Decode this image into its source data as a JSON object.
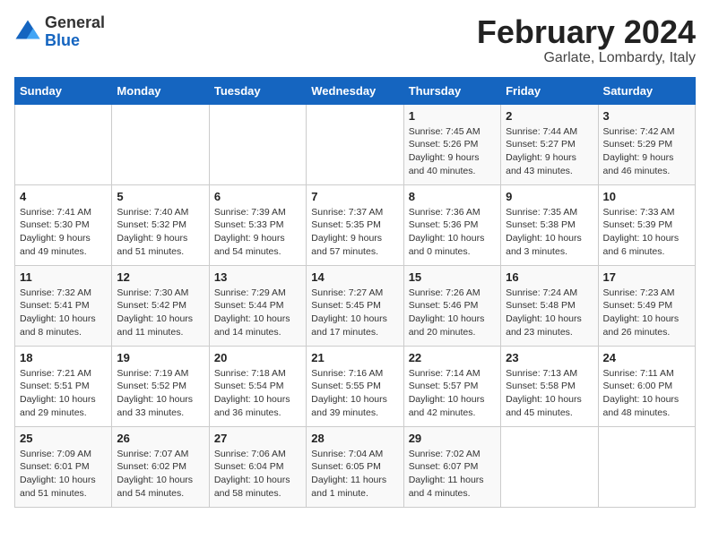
{
  "header": {
    "logo_general": "General",
    "logo_blue": "Blue",
    "title": "February 2024",
    "subtitle": "Garlate, Lombardy, Italy"
  },
  "days_of_week": [
    "Sunday",
    "Monday",
    "Tuesday",
    "Wednesday",
    "Thursday",
    "Friday",
    "Saturday"
  ],
  "weeks": [
    [
      {
        "day": "",
        "info": ""
      },
      {
        "day": "",
        "info": ""
      },
      {
        "day": "",
        "info": ""
      },
      {
        "day": "",
        "info": ""
      },
      {
        "day": "1",
        "info": "Sunrise: 7:45 AM\nSunset: 5:26 PM\nDaylight: 9 hours\nand 40 minutes."
      },
      {
        "day": "2",
        "info": "Sunrise: 7:44 AM\nSunset: 5:27 PM\nDaylight: 9 hours\nand 43 minutes."
      },
      {
        "day": "3",
        "info": "Sunrise: 7:42 AM\nSunset: 5:29 PM\nDaylight: 9 hours\nand 46 minutes."
      }
    ],
    [
      {
        "day": "4",
        "info": "Sunrise: 7:41 AM\nSunset: 5:30 PM\nDaylight: 9 hours\nand 49 minutes."
      },
      {
        "day": "5",
        "info": "Sunrise: 7:40 AM\nSunset: 5:32 PM\nDaylight: 9 hours\nand 51 minutes."
      },
      {
        "day": "6",
        "info": "Sunrise: 7:39 AM\nSunset: 5:33 PM\nDaylight: 9 hours\nand 54 minutes."
      },
      {
        "day": "7",
        "info": "Sunrise: 7:37 AM\nSunset: 5:35 PM\nDaylight: 9 hours\nand 57 minutes."
      },
      {
        "day": "8",
        "info": "Sunrise: 7:36 AM\nSunset: 5:36 PM\nDaylight: 10 hours\nand 0 minutes."
      },
      {
        "day": "9",
        "info": "Sunrise: 7:35 AM\nSunset: 5:38 PM\nDaylight: 10 hours\nand 3 minutes."
      },
      {
        "day": "10",
        "info": "Sunrise: 7:33 AM\nSunset: 5:39 PM\nDaylight: 10 hours\nand 6 minutes."
      }
    ],
    [
      {
        "day": "11",
        "info": "Sunrise: 7:32 AM\nSunset: 5:41 PM\nDaylight: 10 hours\nand 8 minutes."
      },
      {
        "day": "12",
        "info": "Sunrise: 7:30 AM\nSunset: 5:42 PM\nDaylight: 10 hours\nand 11 minutes."
      },
      {
        "day": "13",
        "info": "Sunrise: 7:29 AM\nSunset: 5:44 PM\nDaylight: 10 hours\nand 14 minutes."
      },
      {
        "day": "14",
        "info": "Sunrise: 7:27 AM\nSunset: 5:45 PM\nDaylight: 10 hours\nand 17 minutes."
      },
      {
        "day": "15",
        "info": "Sunrise: 7:26 AM\nSunset: 5:46 PM\nDaylight: 10 hours\nand 20 minutes."
      },
      {
        "day": "16",
        "info": "Sunrise: 7:24 AM\nSunset: 5:48 PM\nDaylight: 10 hours\nand 23 minutes."
      },
      {
        "day": "17",
        "info": "Sunrise: 7:23 AM\nSunset: 5:49 PM\nDaylight: 10 hours\nand 26 minutes."
      }
    ],
    [
      {
        "day": "18",
        "info": "Sunrise: 7:21 AM\nSunset: 5:51 PM\nDaylight: 10 hours\nand 29 minutes."
      },
      {
        "day": "19",
        "info": "Sunrise: 7:19 AM\nSunset: 5:52 PM\nDaylight: 10 hours\nand 33 minutes."
      },
      {
        "day": "20",
        "info": "Sunrise: 7:18 AM\nSunset: 5:54 PM\nDaylight: 10 hours\nand 36 minutes."
      },
      {
        "day": "21",
        "info": "Sunrise: 7:16 AM\nSunset: 5:55 PM\nDaylight: 10 hours\nand 39 minutes."
      },
      {
        "day": "22",
        "info": "Sunrise: 7:14 AM\nSunset: 5:57 PM\nDaylight: 10 hours\nand 42 minutes."
      },
      {
        "day": "23",
        "info": "Sunrise: 7:13 AM\nSunset: 5:58 PM\nDaylight: 10 hours\nand 45 minutes."
      },
      {
        "day": "24",
        "info": "Sunrise: 7:11 AM\nSunset: 6:00 PM\nDaylight: 10 hours\nand 48 minutes."
      }
    ],
    [
      {
        "day": "25",
        "info": "Sunrise: 7:09 AM\nSunset: 6:01 PM\nDaylight: 10 hours\nand 51 minutes."
      },
      {
        "day": "26",
        "info": "Sunrise: 7:07 AM\nSunset: 6:02 PM\nDaylight: 10 hours\nand 54 minutes."
      },
      {
        "day": "27",
        "info": "Sunrise: 7:06 AM\nSunset: 6:04 PM\nDaylight: 10 hours\nand 58 minutes."
      },
      {
        "day": "28",
        "info": "Sunrise: 7:04 AM\nSunset: 6:05 PM\nDaylight: 11 hours\nand 1 minute."
      },
      {
        "day": "29",
        "info": "Sunrise: 7:02 AM\nSunset: 6:07 PM\nDaylight: 11 hours\nand 4 minutes."
      },
      {
        "day": "",
        "info": ""
      },
      {
        "day": "",
        "info": ""
      }
    ]
  ]
}
